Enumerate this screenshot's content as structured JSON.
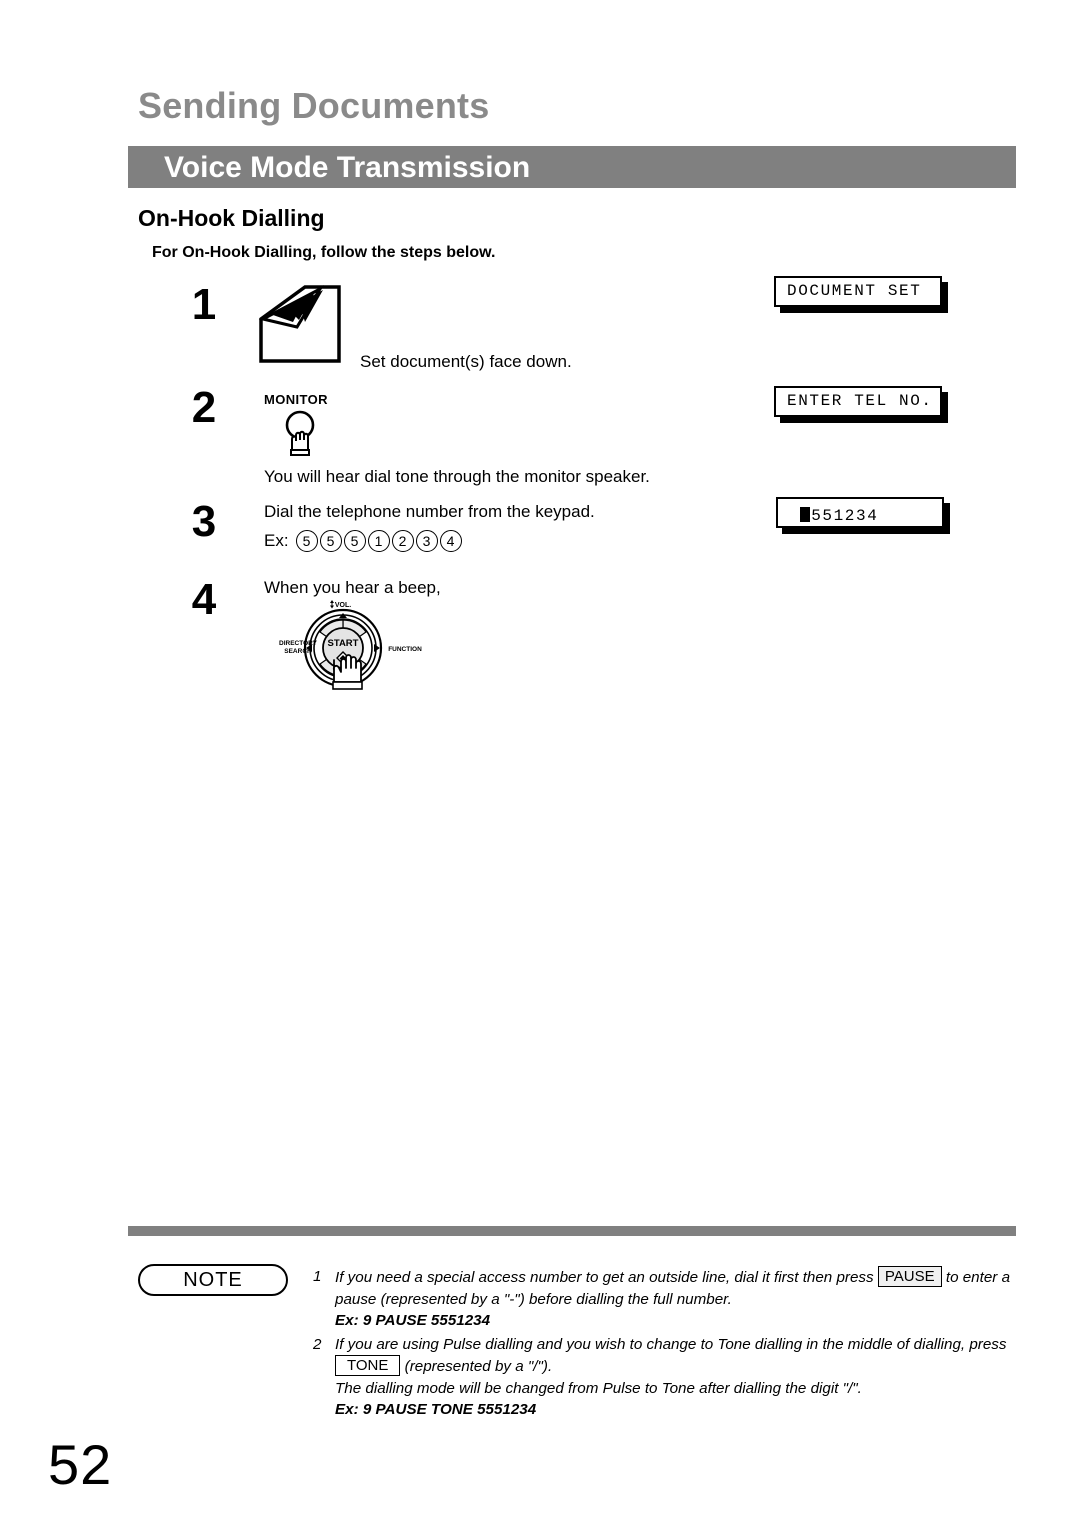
{
  "page": {
    "chapter_title": "Sending Documents",
    "section_title": "Voice Mode Transmission",
    "subsection_title": "On-Hook Dialling",
    "intro": "For On-Hook Dialling, follow the steps below.",
    "page_number": "52",
    "accent_gray": "#808080",
    "chapter_gray": "#8a8a8a"
  },
  "steps": [
    {
      "number": "1",
      "icon": "document-stack-icon",
      "text": "Set document(s) face down."
    },
    {
      "number": "2",
      "icon": "monitor-button-icon",
      "button_label": "MONITOR",
      "text": "You will hear dial tone through the monitor speaker."
    },
    {
      "number": "3",
      "text": "Dial the telephone number from the keypad.",
      "example_label": "Ex:",
      "example_digits": [
        "5",
        "5",
        "5",
        "1",
        "2",
        "3",
        "4"
      ]
    },
    {
      "number": "4",
      "text": "When you hear a beep,",
      "icon": "navigation-dial-icon"
    }
  ],
  "control_panel": {
    "center_label": "START",
    "top_label": "VOL.",
    "left_label_line1": "DIRECTORY",
    "left_label_line2": "SEARCH",
    "right_label": "FUNCTION"
  },
  "displays": [
    {
      "text": "DOCUMENT SET",
      "cursor": false
    },
    {
      "text": "ENTER TEL NO.",
      "cursor": false
    },
    {
      "text": "5551234",
      "cursor": true
    }
  ],
  "note": {
    "badge": "NOTE",
    "items": [
      {
        "marker": "1",
        "part1": "If you need a special access number to get an outside line, dial it first then press",
        "key": "PAUSE",
        "part2": "to enter a pause (represented by a \"-\") before dialling the full number.",
        "example": "Ex: 9 PAUSE 5551234"
      },
      {
        "marker": "2",
        "part1": "If you are using Pulse dialling and you wish to change to Tone dialling in the middle of dialling, press",
        "key": "TONE",
        "part2": "(represented by a \"/\").",
        "part3": "The dialling mode will be changed from Pulse to Tone after dialling the digit \"/\".",
        "example": "Ex: 9 PAUSE TONE 5551234"
      }
    ]
  }
}
